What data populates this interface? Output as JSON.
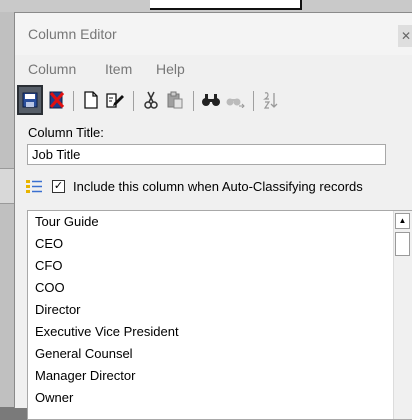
{
  "window": {
    "title": "Column Editor",
    "close_glyph": "✕"
  },
  "menu": [
    "Column",
    "Item",
    "Help"
  ],
  "toolbar": {
    "icons": [
      "save-icon",
      "delete-icon",
      "new-document-icon",
      "edit-icon",
      "cut-icon",
      "paste-icon",
      "find-icon",
      "find-next-icon",
      "sort-icon"
    ]
  },
  "form": {
    "column_title_label": "Column Title:",
    "column_title_value": "Job Title",
    "auto_classify_label": "Include this column when Auto-Classifying records",
    "auto_classify_checked": true
  },
  "list": {
    "items": [
      "Tour Guide",
      "CEO",
      "CFO",
      "COO",
      "Director",
      "Executive Vice President",
      "General Counsel",
      "Manager Director",
      "Owner"
    ]
  },
  "colors": {
    "window_bg": "#f0f0f0",
    "selected_tool_bg": "#565e68",
    "backdrop": "#7a7a7a"
  }
}
